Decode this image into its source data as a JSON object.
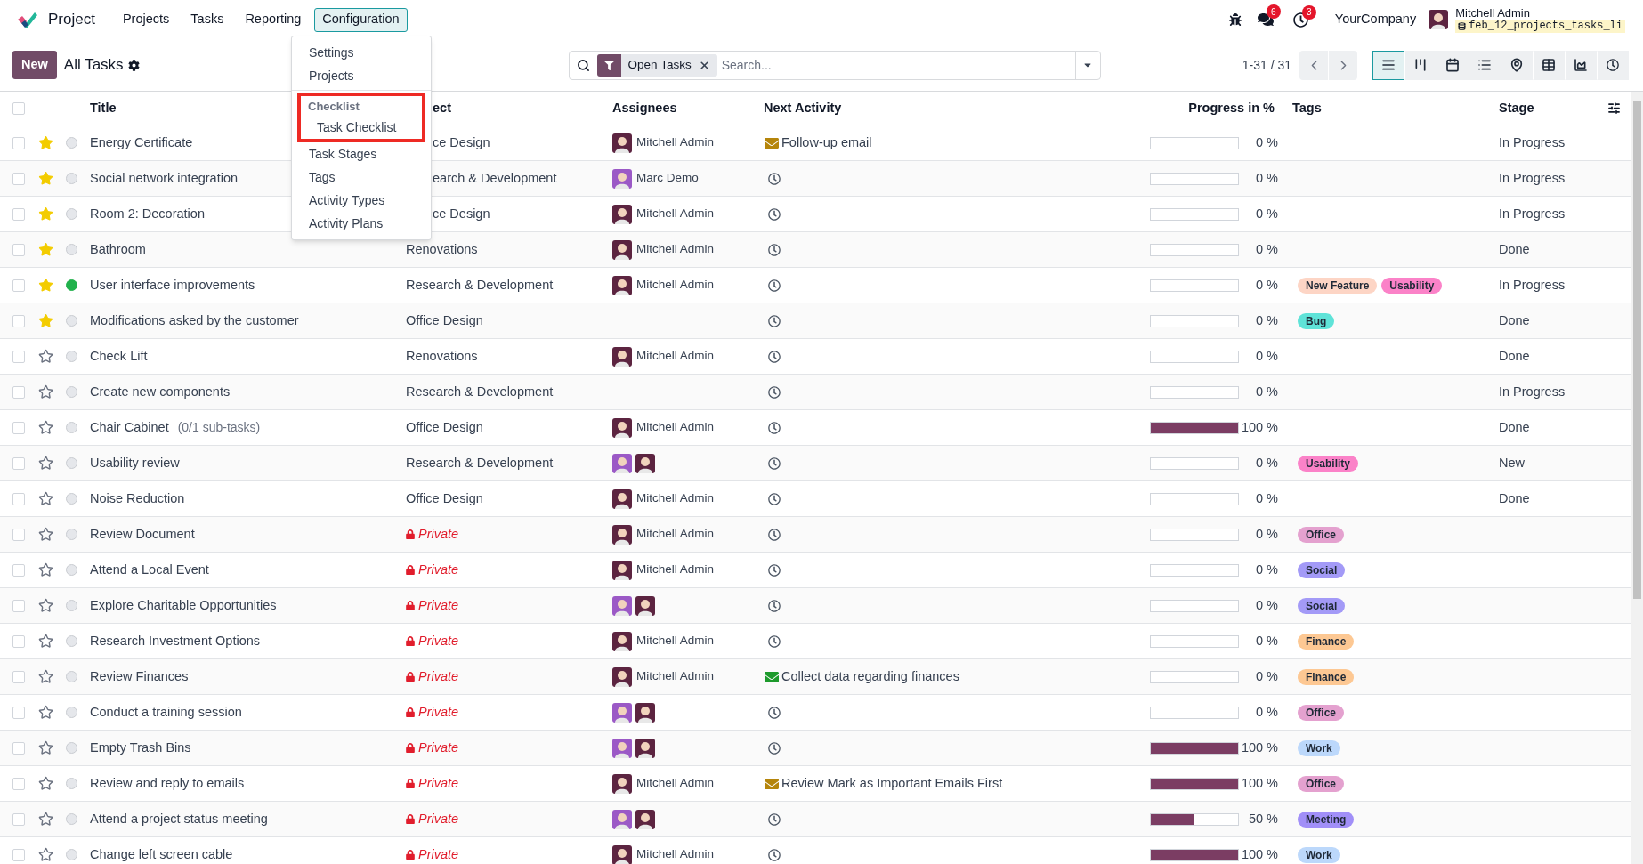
{
  "navbar": {
    "app_name": "Project",
    "menu": [
      {
        "label": "Projects",
        "selected": false
      },
      {
        "label": "Tasks",
        "selected": false
      },
      {
        "label": "Reporting",
        "selected": false
      },
      {
        "label": "Configuration",
        "selected": true
      }
    ],
    "messages_badge": "6",
    "activities_badge": "3",
    "company": "YourCompany",
    "user_name": "Mitchell Admin",
    "database": "feb_12_projects_tasks_li"
  },
  "config_menu": {
    "items": [
      {
        "kind": "item",
        "label": "Settings"
      },
      {
        "kind": "item",
        "label": "Projects"
      },
      {
        "kind": "section",
        "label": "Checklist",
        "highlighted": true,
        "children": [
          {
            "label": "Task Checklist"
          }
        ]
      },
      {
        "kind": "item",
        "label": "Task Stages"
      },
      {
        "kind": "item",
        "label": "Tags"
      },
      {
        "kind": "item",
        "label": "Activity Types"
      },
      {
        "kind": "item",
        "label": "Activity Plans"
      }
    ]
  },
  "control_panel": {
    "new_button": "New",
    "view_title": "All Tasks",
    "search": {
      "facets": [
        {
          "label": "Open Tasks"
        }
      ],
      "placeholder": "Search..."
    },
    "pager": "1-31 / 31",
    "views": [
      {
        "kind": "list",
        "selected": true
      },
      {
        "kind": "kanban",
        "selected": false
      },
      {
        "kind": "calendar",
        "selected": false
      },
      {
        "kind": "gantt",
        "selected": false
      },
      {
        "kind": "map",
        "selected": false
      },
      {
        "kind": "pivot",
        "selected": false
      },
      {
        "kind": "graph",
        "selected": false
      },
      {
        "kind": "activity",
        "selected": false
      }
    ]
  },
  "table": {
    "select_all_checked": false,
    "columns": [
      {
        "kind": "title",
        "label": "Title"
      },
      {
        "kind": "project",
        "label": "ect",
        "covered": true
      },
      {
        "kind": "assignees",
        "label": "Assignees"
      },
      {
        "kind": "activity",
        "label": "Next Activity"
      },
      {
        "kind": "progress",
        "label": "Progress in %"
      },
      {
        "kind": "tags",
        "label": "Tags"
      },
      {
        "kind": "stage",
        "label": "Stage"
      }
    ],
    "rows": [
      {
        "checked": false,
        "title": "Energy Certificate",
        "starred": true,
        "ready": false,
        "project": {
          "kind": "text",
          "label": "ce Design",
          "covered": true
        },
        "assignees": [
          {
            "name": "Mitchell Admin",
            "color": "#5c2440"
          }
        ],
        "activity": {
          "kind": "email",
          "color": "#b5850b",
          "text": "Follow-up email"
        },
        "level": 0,
        "progress": "0 %",
        "tags": [],
        "stage": "In Progress"
      },
      {
        "checked": false,
        "title": "Social network integration",
        "starred": true,
        "ready": false,
        "project": {
          "kind": "text",
          "label": "earch & Development",
          "covered": true
        },
        "assignees": [
          {
            "name": "Marc Demo",
            "color": "#9b59c6"
          }
        ],
        "activity": {
          "kind": "clock"
        },
        "level": 0,
        "progress": "0 %",
        "tags": [],
        "stage": "In Progress"
      },
      {
        "checked": false,
        "title": "Room 2: Decoration",
        "starred": true,
        "ready": false,
        "project": {
          "kind": "text",
          "label": "ce Design",
          "covered": true
        },
        "assignees": [
          {
            "name": "Mitchell Admin",
            "color": "#5c2440"
          }
        ],
        "activity": {
          "kind": "clock"
        },
        "level": 0,
        "progress": "0 %",
        "tags": [],
        "stage": "In Progress"
      },
      {
        "checked": false,
        "title": "Bathroom",
        "starred": true,
        "ready": false,
        "project": {
          "kind": "text",
          "label": "Renovations"
        },
        "assignees": [
          {
            "name": "Mitchell Admin",
            "color": "#5c2440"
          }
        ],
        "activity": {
          "kind": "clock"
        },
        "level": 0,
        "progress": "0 %",
        "tags": [],
        "stage": "Done"
      },
      {
        "checked": false,
        "title": "User interface improvements",
        "starred": true,
        "ready": true,
        "project": {
          "kind": "text",
          "label": "Research & Development"
        },
        "assignees": [
          {
            "name": "Mitchell Admin",
            "color": "#5c2440"
          }
        ],
        "activity": {
          "kind": "clock"
        },
        "level": 0,
        "progress": "0 %",
        "tags": [
          {
            "label": "New Feature",
            "color": "#fdd5c5"
          },
          {
            "label": "Usability",
            "color": "#fb82c8"
          }
        ],
        "stage": "In Progress"
      },
      {
        "checked": false,
        "title": "Modifications asked by the customer",
        "starred": true,
        "ready": false,
        "project": {
          "kind": "text",
          "label": "Office Design"
        },
        "assignees": [],
        "activity": {
          "kind": "clock"
        },
        "level": 0,
        "progress": "0 %",
        "tags": [
          {
            "label": "Bug",
            "color": "#5fe3d8"
          }
        ],
        "stage": "Done"
      },
      {
        "checked": false,
        "title": "Check Lift",
        "starred": false,
        "ready": false,
        "project": {
          "kind": "text",
          "label": "Renovations"
        },
        "assignees": [
          {
            "name": "Mitchell Admin",
            "color": "#5c2440"
          }
        ],
        "activity": {
          "kind": "clock"
        },
        "level": 0,
        "progress": "0 %",
        "tags": [],
        "stage": "Done"
      },
      {
        "checked": false,
        "title": "Create new components",
        "starred": false,
        "ready": false,
        "project": {
          "kind": "text",
          "label": "Research & Development"
        },
        "assignees": [],
        "activity": {
          "kind": "clock"
        },
        "level": 0,
        "progress": "0 %",
        "tags": [],
        "stage": "In Progress"
      },
      {
        "checked": false,
        "title": "Chair Cabinet",
        "subtitle": "(0/1 sub-tasks)",
        "starred": false,
        "ready": false,
        "project": {
          "kind": "text",
          "label": "Office Design"
        },
        "assignees": [
          {
            "name": "Mitchell Admin",
            "color": "#5c2440"
          }
        ],
        "activity": {
          "kind": "clock"
        },
        "level": 1,
        "progress": "100 %",
        "tags": [],
        "stage": "Done"
      },
      {
        "checked": false,
        "title": "Usability review",
        "starred": false,
        "ready": false,
        "project": {
          "kind": "text",
          "label": "Research & Development"
        },
        "assignees": [
          {
            "color": "#9b59c6"
          },
          {
            "color": "#5c2440"
          }
        ],
        "activity": {
          "kind": "clock"
        },
        "level": 0,
        "progress": "0 %",
        "tags": [
          {
            "label": "Usability",
            "color": "#fb82c8"
          }
        ],
        "stage": "New"
      },
      {
        "checked": false,
        "title": "Noise Reduction",
        "starred": false,
        "ready": false,
        "project": {
          "kind": "text",
          "label": "Office Design"
        },
        "assignees": [
          {
            "name": "Mitchell Admin",
            "color": "#5c2440"
          }
        ],
        "activity": {
          "kind": "clock"
        },
        "level": 0,
        "progress": "0 %",
        "tags": [],
        "stage": "Done"
      },
      {
        "checked": false,
        "title": "Review Document",
        "starred": false,
        "ready": false,
        "project": {
          "kind": "private",
          "label": "Private"
        },
        "assignees": [
          {
            "name": "Mitchell Admin",
            "color": "#5c2440"
          }
        ],
        "activity": {
          "kind": "clock"
        },
        "level": 0,
        "progress": "0 %",
        "tags": [
          {
            "label": "Office",
            "color": "#e4a1cf"
          }
        ]
      },
      {
        "checked": false,
        "title": "Attend a Local Event",
        "starred": false,
        "ready": false,
        "project": {
          "kind": "private",
          "label": "Private"
        },
        "assignees": [
          {
            "name": "Mitchell Admin",
            "color": "#5c2440"
          }
        ],
        "activity": {
          "kind": "clock"
        },
        "level": 0,
        "progress": "0 %",
        "tags": [
          {
            "label": "Social",
            "color": "#a39af7"
          }
        ]
      },
      {
        "checked": false,
        "title": "Explore Charitable Opportunities",
        "starred": false,
        "ready": false,
        "project": {
          "kind": "private",
          "label": "Private"
        },
        "assignees": [
          {
            "color": "#9b59c6"
          },
          {
            "color": "#5c2440"
          }
        ],
        "activity": {
          "kind": "clock"
        },
        "level": 0,
        "progress": "0 %",
        "tags": [
          {
            "label": "Social",
            "color": "#a39af7"
          }
        ]
      },
      {
        "checked": false,
        "title": "Research Investment Options",
        "starred": false,
        "ready": false,
        "project": {
          "kind": "private",
          "label": "Private"
        },
        "assignees": [
          {
            "name": "Mitchell Admin",
            "color": "#5c2440"
          }
        ],
        "activity": {
          "kind": "clock"
        },
        "level": 0,
        "progress": "0 %",
        "tags": [
          {
            "label": "Finance",
            "color": "#fdc893"
          }
        ]
      },
      {
        "checked": false,
        "title": "Review Finances",
        "starred": false,
        "ready": false,
        "project": {
          "kind": "private",
          "label": "Private"
        },
        "assignees": [
          {
            "name": "Mitchell Admin",
            "color": "#5c2440"
          }
        ],
        "activity": {
          "kind": "email",
          "color": "#1d9a2c",
          "text": "Collect data regarding finances"
        },
        "level": 0,
        "progress": "0 %",
        "tags": [
          {
            "label": "Finance",
            "color": "#fdc893"
          }
        ]
      },
      {
        "checked": false,
        "title": "Conduct a training session",
        "starred": false,
        "ready": false,
        "project": {
          "kind": "private",
          "label": "Private"
        },
        "assignees": [
          {
            "color": "#9b59c6"
          },
          {
            "color": "#5c2440"
          }
        ],
        "activity": {
          "kind": "clock"
        },
        "level": 0,
        "progress": "0 %",
        "tags": [
          {
            "label": "Office",
            "color": "#e4a1cf"
          }
        ]
      },
      {
        "checked": false,
        "title": "Empty Trash Bins",
        "starred": false,
        "ready": false,
        "project": {
          "kind": "private",
          "label": "Private"
        },
        "assignees": [
          {
            "color": "#9b59c6"
          },
          {
            "color": "#5c2440"
          }
        ],
        "activity": {
          "kind": "clock"
        },
        "level": 1,
        "progress": "100 %",
        "tags": [
          {
            "label": "Work",
            "color": "#bcd8fb"
          }
        ]
      },
      {
        "checked": false,
        "title": "Review and reply to emails",
        "starred": false,
        "ready": false,
        "project": {
          "kind": "private",
          "label": "Private"
        },
        "assignees": [
          {
            "name": "Mitchell Admin",
            "color": "#5c2440"
          }
        ],
        "activity": {
          "kind": "email",
          "color": "#b5850b",
          "text": "Review Mark as Important Emails First"
        },
        "level": 1,
        "progress": "100 %",
        "tags": [
          {
            "label": "Office",
            "color": "#e4a1cf"
          }
        ]
      },
      {
        "checked": false,
        "title": "Attend a project status meeting",
        "starred": false,
        "ready": false,
        "project": {
          "kind": "private",
          "label": "Private"
        },
        "assignees": [
          {
            "color": "#9b59c6"
          },
          {
            "color": "#5c2440"
          }
        ],
        "activity": {
          "kind": "clock"
        },
        "level": 0.5,
        "progress": "50 %",
        "tags": [
          {
            "label": "Meeting",
            "color": "#a18ff8"
          }
        ]
      },
      {
        "checked": false,
        "title": "Change left screen cable",
        "starred": false,
        "ready": false,
        "project": {
          "kind": "private",
          "label": "Private"
        },
        "assignees": [
          {
            "name": "Mitchell Admin",
            "color": "#5c2440"
          }
        ],
        "activity": {
          "kind": "clock"
        },
        "level": 1,
        "progress": "100 %",
        "tags": [
          {
            "label": "Work",
            "color": "#bcd8fb"
          }
        ]
      }
    ]
  }
}
